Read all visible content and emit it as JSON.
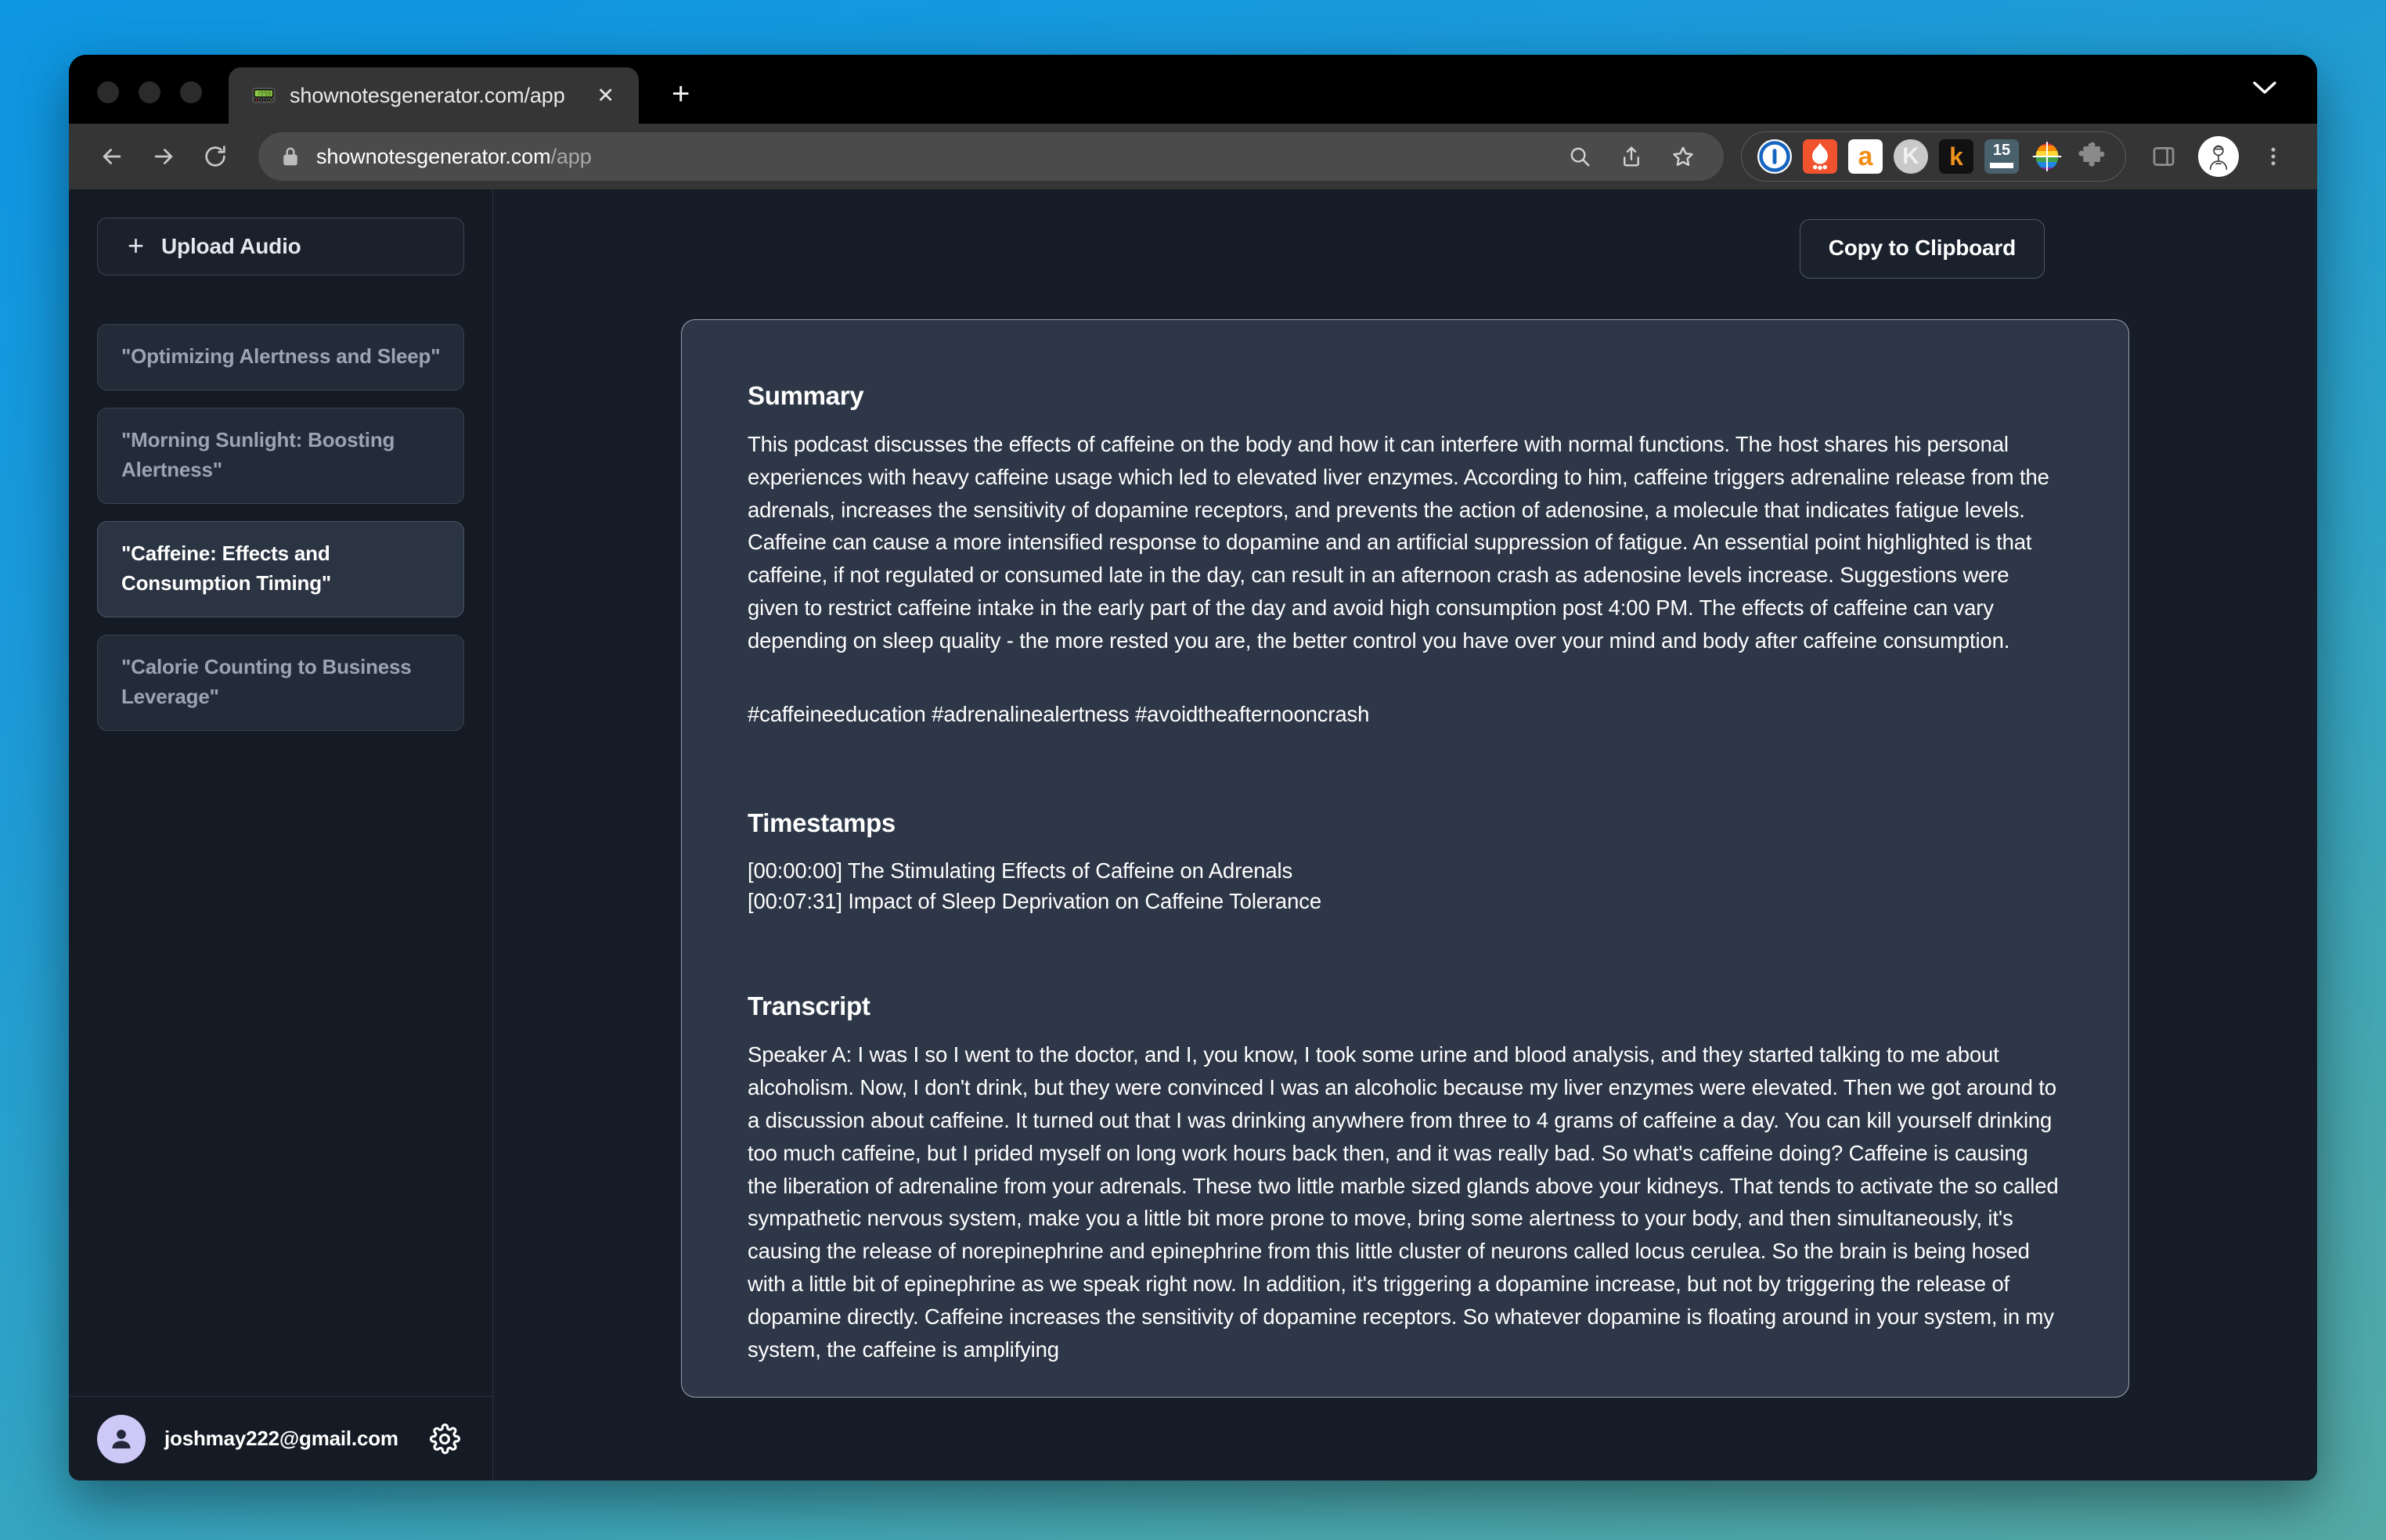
{
  "browser": {
    "tab": {
      "favicon": "pager-icon",
      "favicon_glyph": "📟",
      "title": "shownotesgenerator.com/app",
      "close_glyph": "✕"
    },
    "new_tab_glyph": "+",
    "omnibox": {
      "url_bold": "shownotesgenerator.com",
      "url_dim": "/app",
      "full_url": "shownotesgenerator.com/app"
    },
    "extensions": [
      {
        "name": "ublock-origin-extension",
        "label": "0",
        "bg": "#ffffff",
        "fg": "#1565c0"
      },
      {
        "name": "hotjar-extension",
        "label": "🔥",
        "bg": "#f2532f",
        "fg": "#ffffff"
      },
      {
        "name": "adblock-extension",
        "label": "a",
        "bg": "#ffffff",
        "fg": "#f28e18"
      },
      {
        "name": "kameleo-extension",
        "label": "K",
        "bg": "#c9c9c9",
        "fg": "#ffffff"
      },
      {
        "name": "keeper-extension",
        "label": "k",
        "bg": "#111111",
        "fg": "#f0921e"
      },
      {
        "name": "calendar-extension",
        "label": "15",
        "bg": "#49606d",
        "fg": "#ffffff"
      },
      {
        "name": "color-picker-extension",
        "label": "",
        "bg": "transparent",
        "fg": "#ffffff"
      },
      {
        "name": "puzzle-extensions-menu",
        "label": "🧩",
        "bg": "transparent",
        "fg": "#8a8a8a"
      }
    ]
  },
  "sidebar": {
    "upload_button": {
      "label": "Upload Audio",
      "plus": "+"
    },
    "episodes": [
      {
        "title": "\"Optimizing Alertness and Sleep\"",
        "active": false
      },
      {
        "title": "\"Morning Sunlight: Boosting Alertness\"",
        "active": false
      },
      {
        "title": "\"Caffeine: Effects and Consumption Timing\"",
        "active": true
      },
      {
        "title": "\"Calorie Counting to Business Leverage\"",
        "active": false
      }
    ],
    "footer": {
      "email": "joshmay222@gmail.com",
      "avatar_icon": "person-icon",
      "settings_icon": "gear-icon"
    }
  },
  "main": {
    "copy_button_label": "Copy to Clipboard",
    "summary": {
      "heading": "Summary",
      "body": "This podcast discusses the effects of caffeine on the body and how it can interfere with normal functions. The host shares his personal experiences with heavy caffeine usage which led to elevated liver enzymes. According to him, caffeine triggers adrenaline release from the adrenals, increases the sensitivity of dopamine receptors, and prevents the action of adenosine, a molecule that indicates fatigue levels. Caffeine can cause a more intensified response to dopamine and an artificial suppression of fatigue. An essential point highlighted is that caffeine, if not regulated or consumed late in the day, can result in an afternoon crash as adenosine levels increase. Suggestions were given to restrict caffeine intake in the early part of the day and avoid high consumption post 4:00 PM. The effects of caffeine can vary depending on sleep quality - the more rested you are, the better control you have over your mind and body after caffeine consumption.",
      "hashtags": "#caffeineeducation #adrenalinealertness #avoidtheafternooncrash"
    },
    "timestamps": {
      "heading": "Timestamps",
      "entries": [
        "[00:00:00] The Stimulating Effects of Caffeine on Adrenals",
        "[00:07:31] Impact of Sleep Deprivation on Caffeine Tolerance"
      ]
    },
    "transcript": {
      "heading": "Transcript",
      "body": "Speaker A: I was I so I went to the doctor, and I, you know, I took some urine and blood analysis, and they started talking to me about alcoholism. Now, I don't drink, but they were convinced I was an alcoholic because my liver enzymes were elevated. Then we got around to a discussion about caffeine. It turned out that I was drinking anywhere from three to 4 grams of caffeine a day. You can kill yourself drinking too much caffeine, but I prided myself on long work hours back then, and it was really bad. So what's caffeine doing? Caffeine is causing the liberation of adrenaline from your adrenals. These two little marble sized glands above your kidneys. That tends to activate the so called sympathetic nervous system, make you a little bit more prone to move, bring some alertness to your body, and then simultaneously, it's causing the release of norepinephrine and epinephrine from this little cluster of neurons called locus cerulea. So the brain is being hosed with a little bit of epinephrine as we speak right now. In addition, it's triggering a dopamine increase, but not by triggering the release of dopamine directly. Caffeine increases the sensitivity of dopamine receptors. So whatever dopamine is floating around in your system, in my system, the caffeine is amplifying"
    }
  },
  "colors": {
    "card_bg": "#2e3748",
    "page_bg": "#161d28",
    "sidebar_bg": "#151b24",
    "accent_avatar": "#cdc8f5",
    "desktop_gradient_start": "#0d96e2",
    "desktop_gradient_end": "#54a9a6"
  }
}
